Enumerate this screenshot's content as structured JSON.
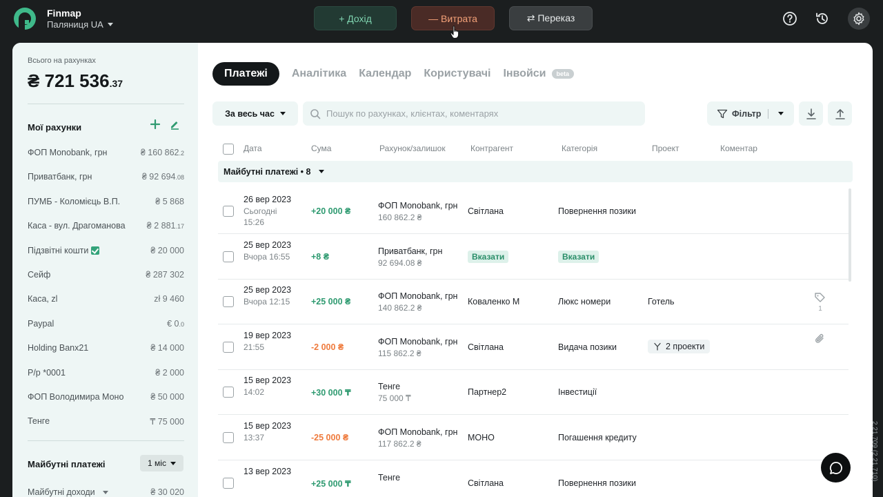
{
  "app": {
    "brand": "Finmap",
    "company": "Паляниця UA",
    "version": "2.21.709 (2.21.710)"
  },
  "topbar": {
    "income_label": "+ Дохід",
    "expense_label": "— Витрата",
    "transfer_label": "⇄ Переказ"
  },
  "sidebar": {
    "total_label": "Всього на рахунках",
    "total_main": "₴ 721 536",
    "total_cents": ".37",
    "accounts_title": "Мої рахунки",
    "accounts": [
      {
        "name": "ФОП Monobank, грн",
        "value": "₴ 160 862",
        "cents": ".2"
      },
      {
        "name": "Приватбанк, грн",
        "value": "₴ 92 694",
        "cents": ".08"
      },
      {
        "name": "ПУМБ - Коломієць В.П.",
        "value": "₴ 5 868",
        "cents": ""
      },
      {
        "name": "Каса - вул. Драгоманова",
        "value": "₴ 2 881",
        "cents": ".17"
      },
      {
        "name": "Підзвітні кошти",
        "value": "₴ 20 000",
        "cents": ""
      },
      {
        "name": "Сейф",
        "value": "₴ 287 302",
        "cents": ""
      },
      {
        "name": "Каса, zl",
        "value": "zł 9 460",
        "cents": ""
      },
      {
        "name": "Paypal",
        "value": "€ 0",
        "cents": ".0"
      },
      {
        "name": "Holding Banx21",
        "value": "₴ 14 000",
        "cents": ""
      },
      {
        "name": "Р/р *0001",
        "value": "₴ 2 000",
        "cents": ""
      },
      {
        "name": "ФОП Володимира Моно",
        "value": "₴ 50 000",
        "cents": ""
      },
      {
        "name": "Тенге",
        "value": "₸ 75 000",
        "cents": ""
      }
    ],
    "future_title": "Майбутні платежі",
    "future_period": "1 міс",
    "future_income_label": "Майбутні доходи",
    "future_income_value": "₴ 30 020"
  },
  "tabs": [
    {
      "label": "Платежі"
    },
    {
      "label": "Аналітика"
    },
    {
      "label": "Календар"
    },
    {
      "label": "Користувачі"
    },
    {
      "label": "Інвойси"
    }
  ],
  "beta_label": "beta",
  "toolbar": {
    "period": "За весь час",
    "search_placeholder": "Пошук по рахунках, клієнтах, коментарях",
    "filter_label": "Фільтр"
  },
  "table": {
    "headers": [
      "Дата",
      "Сума",
      "Рахунок/залишок",
      "Контрагент",
      "Категорія",
      "Проект",
      "Коментар"
    ],
    "future_bar": "Майбутні платежі • 8",
    "rows": [
      {
        "date": "26 вер 2023",
        "sub": "Сьогодні",
        "sub2": "15:26",
        "amount": "+20 000 ₴",
        "amount_type": "pos",
        "account": "ФОП Monobank, грн",
        "balance": "160 862.2 ₴",
        "counterparty": "Світлана",
        "category": "Повернення позики",
        "project": ""
      },
      {
        "date": "25 вер 2023",
        "sub": "Вчора 16:55",
        "sub2": "",
        "amount": "+8 ₴",
        "amount_type": "pos",
        "account": "Приватбанк, грн",
        "balance": "92 694.08 ₴",
        "counterparty": "Вказати",
        "category": "Вказати",
        "project": ""
      },
      {
        "date": "25 вер 2023",
        "sub": "Вчора 12:15",
        "sub2": "",
        "amount": "+25 000 ₴",
        "amount_type": "pos",
        "account": "ФОП Monobank, грн",
        "balance": "140 862.2 ₴",
        "counterparty": "Коваленко М",
        "category": "Люкс номери",
        "project": "Готель",
        "tag_count": "1"
      },
      {
        "date": "19 вер 2023",
        "sub": "21:55",
        "sub2": "",
        "amount": "-2 000 ₴",
        "amount_type": "neg",
        "account": "ФОП Monobank, грн",
        "balance": "115 862.2 ₴",
        "counterparty": "Світлана",
        "category": "Видача позики",
        "project": "2 проекти"
      },
      {
        "date": "15 вер 2023",
        "sub": "14:02",
        "sub2": "",
        "amount": "+30 000 ₸",
        "amount_type": "pos",
        "account": "Тенге",
        "balance": "75 000 ₸",
        "counterparty": "Партнер2",
        "category": "Інвестиції",
        "project": ""
      },
      {
        "date": "15 вер 2023",
        "sub": "13:37",
        "sub2": "",
        "amount": "-25 000 ₴",
        "amount_type": "neg",
        "account": "ФОП Monobank, грн",
        "balance": "117 862.2 ₴",
        "counterparty": "МОНО",
        "category": "Погашення кредиту",
        "project": ""
      },
      {
        "date": "13 вер 2023",
        "sub": "",
        "sub2": "",
        "amount": "+25 000 ₸",
        "amount_type": "pos",
        "account": "Тенге",
        "balance": "",
        "counterparty": "Світлана",
        "category": "Повернення позики",
        "project": ""
      }
    ]
  }
}
